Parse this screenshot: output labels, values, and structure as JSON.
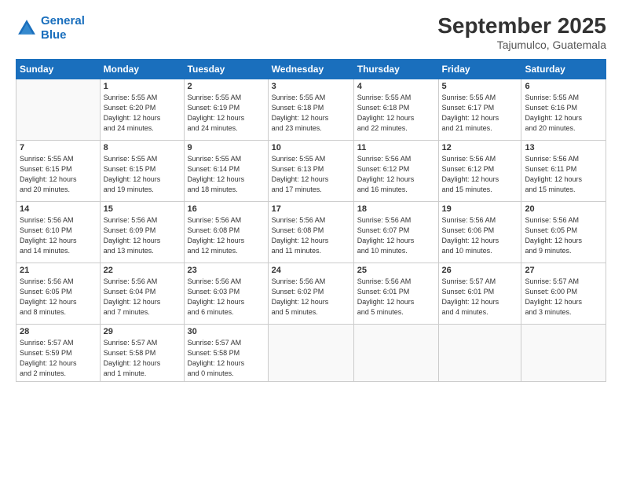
{
  "header": {
    "logo_line1": "General",
    "logo_line2": "Blue",
    "month_title": "September 2025",
    "location": "Tajumulco, Guatemala"
  },
  "weekdays": [
    "Sunday",
    "Monday",
    "Tuesday",
    "Wednesday",
    "Thursday",
    "Friday",
    "Saturday"
  ],
  "weeks": [
    [
      {
        "day": "",
        "info": ""
      },
      {
        "day": "1",
        "info": "Sunrise: 5:55 AM\nSunset: 6:20 PM\nDaylight: 12 hours\nand 24 minutes."
      },
      {
        "day": "2",
        "info": "Sunrise: 5:55 AM\nSunset: 6:19 PM\nDaylight: 12 hours\nand 24 minutes."
      },
      {
        "day": "3",
        "info": "Sunrise: 5:55 AM\nSunset: 6:18 PM\nDaylight: 12 hours\nand 23 minutes."
      },
      {
        "day": "4",
        "info": "Sunrise: 5:55 AM\nSunset: 6:18 PM\nDaylight: 12 hours\nand 22 minutes."
      },
      {
        "day": "5",
        "info": "Sunrise: 5:55 AM\nSunset: 6:17 PM\nDaylight: 12 hours\nand 21 minutes."
      },
      {
        "day": "6",
        "info": "Sunrise: 5:55 AM\nSunset: 6:16 PM\nDaylight: 12 hours\nand 20 minutes."
      }
    ],
    [
      {
        "day": "7",
        "info": "Sunrise: 5:55 AM\nSunset: 6:15 PM\nDaylight: 12 hours\nand 20 minutes."
      },
      {
        "day": "8",
        "info": "Sunrise: 5:55 AM\nSunset: 6:15 PM\nDaylight: 12 hours\nand 19 minutes."
      },
      {
        "day": "9",
        "info": "Sunrise: 5:55 AM\nSunset: 6:14 PM\nDaylight: 12 hours\nand 18 minutes."
      },
      {
        "day": "10",
        "info": "Sunrise: 5:55 AM\nSunset: 6:13 PM\nDaylight: 12 hours\nand 17 minutes."
      },
      {
        "day": "11",
        "info": "Sunrise: 5:56 AM\nSunset: 6:12 PM\nDaylight: 12 hours\nand 16 minutes."
      },
      {
        "day": "12",
        "info": "Sunrise: 5:56 AM\nSunset: 6:12 PM\nDaylight: 12 hours\nand 15 minutes."
      },
      {
        "day": "13",
        "info": "Sunrise: 5:56 AM\nSunset: 6:11 PM\nDaylight: 12 hours\nand 15 minutes."
      }
    ],
    [
      {
        "day": "14",
        "info": "Sunrise: 5:56 AM\nSunset: 6:10 PM\nDaylight: 12 hours\nand 14 minutes."
      },
      {
        "day": "15",
        "info": "Sunrise: 5:56 AM\nSunset: 6:09 PM\nDaylight: 12 hours\nand 13 minutes."
      },
      {
        "day": "16",
        "info": "Sunrise: 5:56 AM\nSunset: 6:08 PM\nDaylight: 12 hours\nand 12 minutes."
      },
      {
        "day": "17",
        "info": "Sunrise: 5:56 AM\nSunset: 6:08 PM\nDaylight: 12 hours\nand 11 minutes."
      },
      {
        "day": "18",
        "info": "Sunrise: 5:56 AM\nSunset: 6:07 PM\nDaylight: 12 hours\nand 10 minutes."
      },
      {
        "day": "19",
        "info": "Sunrise: 5:56 AM\nSunset: 6:06 PM\nDaylight: 12 hours\nand 10 minutes."
      },
      {
        "day": "20",
        "info": "Sunrise: 5:56 AM\nSunset: 6:05 PM\nDaylight: 12 hours\nand 9 minutes."
      }
    ],
    [
      {
        "day": "21",
        "info": "Sunrise: 5:56 AM\nSunset: 6:05 PM\nDaylight: 12 hours\nand 8 minutes."
      },
      {
        "day": "22",
        "info": "Sunrise: 5:56 AM\nSunset: 6:04 PM\nDaylight: 12 hours\nand 7 minutes."
      },
      {
        "day": "23",
        "info": "Sunrise: 5:56 AM\nSunset: 6:03 PM\nDaylight: 12 hours\nand 6 minutes."
      },
      {
        "day": "24",
        "info": "Sunrise: 5:56 AM\nSunset: 6:02 PM\nDaylight: 12 hours\nand 5 minutes."
      },
      {
        "day": "25",
        "info": "Sunrise: 5:56 AM\nSunset: 6:01 PM\nDaylight: 12 hours\nand 5 minutes."
      },
      {
        "day": "26",
        "info": "Sunrise: 5:57 AM\nSunset: 6:01 PM\nDaylight: 12 hours\nand 4 minutes."
      },
      {
        "day": "27",
        "info": "Sunrise: 5:57 AM\nSunset: 6:00 PM\nDaylight: 12 hours\nand 3 minutes."
      }
    ],
    [
      {
        "day": "28",
        "info": "Sunrise: 5:57 AM\nSunset: 5:59 PM\nDaylight: 12 hours\nand 2 minutes."
      },
      {
        "day": "29",
        "info": "Sunrise: 5:57 AM\nSunset: 5:58 PM\nDaylight: 12 hours\nand 1 minute."
      },
      {
        "day": "30",
        "info": "Sunrise: 5:57 AM\nSunset: 5:58 PM\nDaylight: 12 hours\nand 0 minutes."
      },
      {
        "day": "",
        "info": ""
      },
      {
        "day": "",
        "info": ""
      },
      {
        "day": "",
        "info": ""
      },
      {
        "day": "",
        "info": ""
      }
    ]
  ]
}
